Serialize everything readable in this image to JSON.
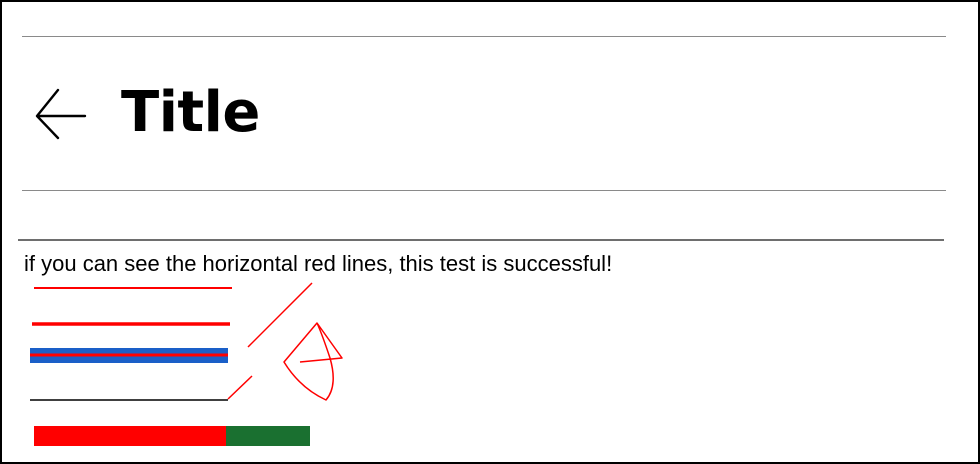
{
  "header": {
    "title": "Title",
    "back_icon": "arrow-left-icon"
  },
  "content": {
    "message": "if you can see the horizontal red lines, this test is successful!"
  },
  "colors": {
    "test_line": "#ff0000",
    "band_blue": "#1a5fc8",
    "bar_red": "#ff0000",
    "bar_green": "#1a7030",
    "rule": "#8a8a8a"
  }
}
